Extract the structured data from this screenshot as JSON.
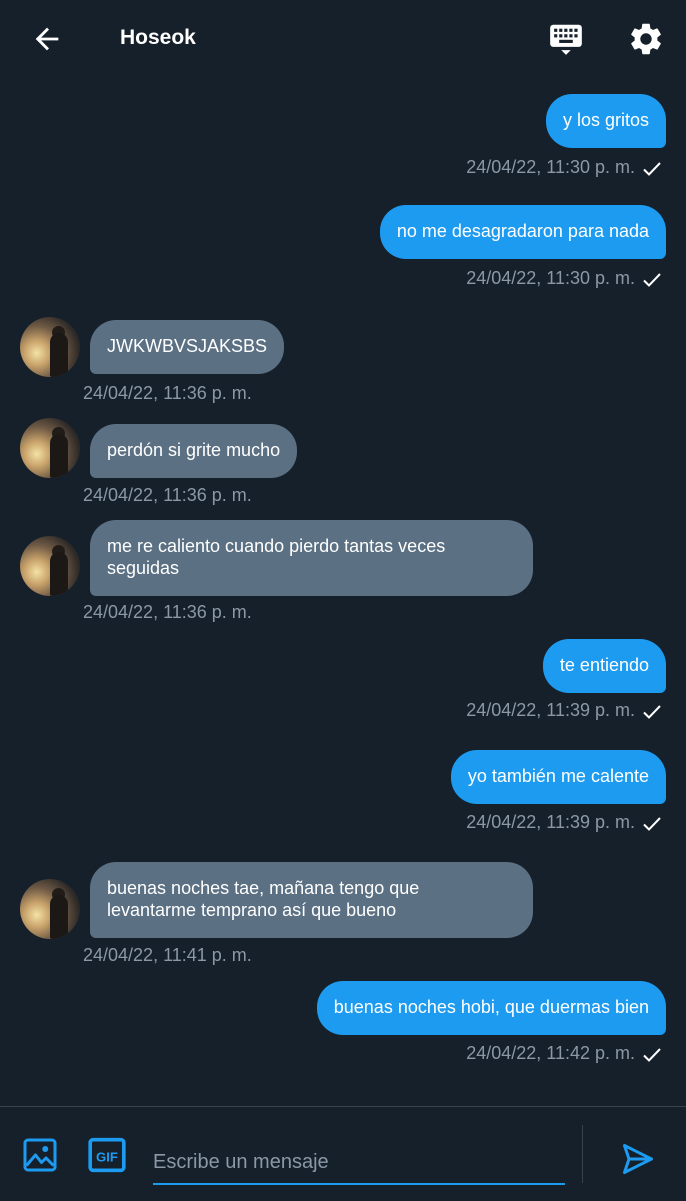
{
  "header": {
    "title": "Hoseok",
    "icons": [
      "arrow-left-icon",
      "keyboard-icon",
      "gear-icon"
    ]
  },
  "messages": [
    {
      "direction": "sent",
      "text": "y los gritos",
      "timestamp": "24/04/22, 11:30 p. m.",
      "read": true
    },
    {
      "direction": "sent",
      "text": "no me desagradaron para nada",
      "timestamp": "24/04/22, 11:30 p. m.",
      "read": true
    },
    {
      "direction": "received",
      "text": "JWKWBVSJAKSBS",
      "timestamp": "24/04/22, 11:36 p. m."
    },
    {
      "direction": "received",
      "text": "perdón si grite mucho",
      "timestamp": "24/04/22, 11:36 p. m."
    },
    {
      "direction": "received",
      "text": "me re caliento cuando pierdo tantas veces\nseguidas",
      "timestamp": "24/04/22, 11:36 p. m."
    },
    {
      "direction": "sent",
      "text": "te entiendo",
      "timestamp": "24/04/22, 11:39 p. m.",
      "read": true
    },
    {
      "direction": "sent",
      "text": "yo también me calente",
      "timestamp": "24/04/22, 11:39 p. m.",
      "read": true
    },
    {
      "direction": "received",
      "text": "buenas noches tae, mañana tengo que\nlevantarme temprano así que bueno",
      "timestamp": "24/04/22, 11:41 p. m."
    },
    {
      "direction": "sent",
      "text": "buenas noches hobi, que duermas bien",
      "timestamp": "24/04/22, 11:42 p. m.",
      "read": true
    }
  ],
  "composer": {
    "placeholder": "Escribe un mensaje",
    "value": "",
    "gif_label": "GIF",
    "icons": [
      "image-icon",
      "gif-icon",
      "send-icon"
    ]
  },
  "colors": {
    "background": "#15202b",
    "sent_bubble": "#1d9bf0",
    "received_bubble": "#5b7083",
    "timestamp": "#8b98a5",
    "accent": "#1d9bf0"
  }
}
